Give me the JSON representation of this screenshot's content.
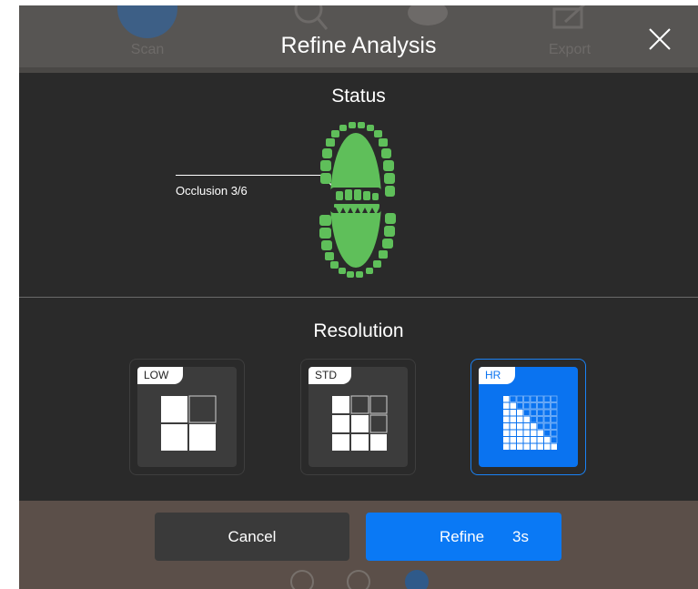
{
  "background_toolbar": {
    "scan_label": "Scan",
    "export_label": "Export"
  },
  "dialog": {
    "title": "Refine Analysis",
    "close_icon": "close-icon",
    "status_title": "Status",
    "occlusion_label": "Occlusion 3/6",
    "resolution_title": "Resolution",
    "resolutions": [
      {
        "tag": "LOW",
        "selected": false
      },
      {
        "tag": "STD",
        "selected": false
      },
      {
        "tag": "HR",
        "selected": true
      }
    ],
    "cancel_label": "Cancel",
    "refine_label": "Refine",
    "refine_timer": "3s"
  },
  "colors": {
    "accent": "#0a79f5",
    "teeth": "#5fbf5a",
    "panel": "#2a2a2a"
  }
}
